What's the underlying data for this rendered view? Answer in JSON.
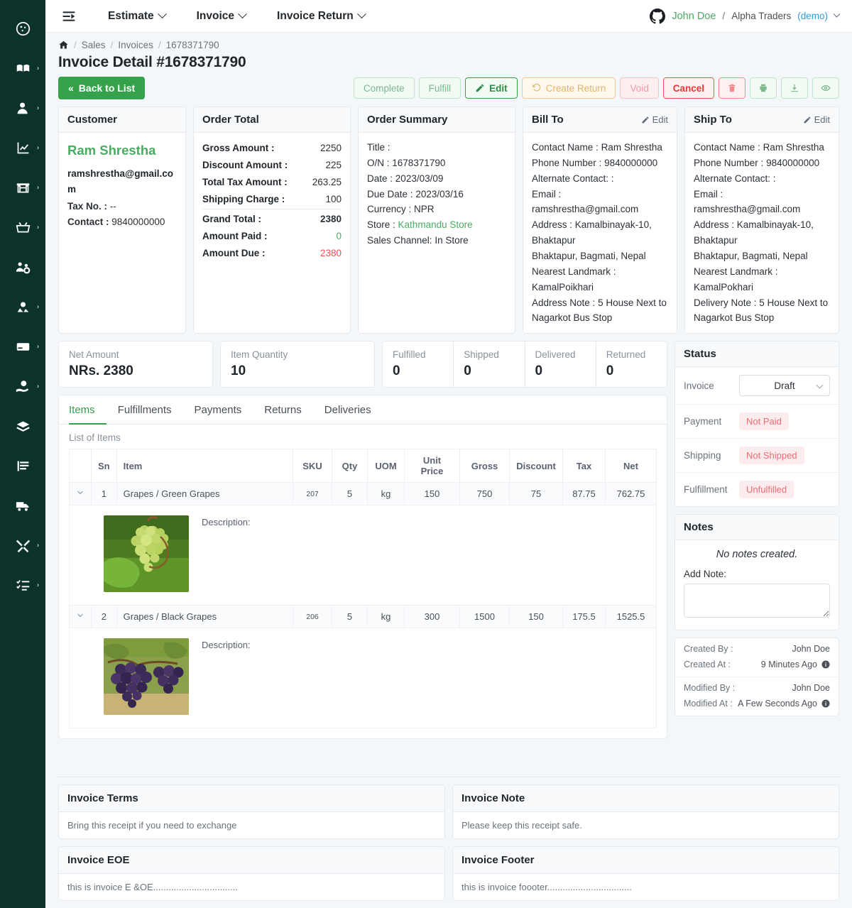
{
  "sidebar": {
    "items": [
      {
        "name": "dashboard",
        "icon": "dashboard-icon",
        "has_caret": false
      },
      {
        "name": "catalog",
        "icon": "book-icon",
        "has_caret": true
      },
      {
        "name": "customers",
        "icon": "user-icon",
        "has_caret": true
      },
      {
        "name": "reports",
        "icon": "chart-line-icon",
        "has_caret": true
      },
      {
        "name": "store",
        "icon": "store-icon",
        "has_caret": true
      },
      {
        "name": "sales",
        "icon": "basket-icon",
        "has_caret": true
      },
      {
        "name": "staff",
        "icon": "users-gear-icon",
        "has_caret": false
      },
      {
        "name": "suppliers",
        "icon": "people-icon",
        "has_caret": true
      },
      {
        "name": "payments",
        "icon": "card-icon",
        "has_caret": true
      },
      {
        "name": "expenses",
        "icon": "hand-money-icon",
        "has_caret": false
      },
      {
        "name": "inventory",
        "icon": "layers-icon",
        "has_caret": false
      },
      {
        "name": "accounting",
        "icon": "ledger-icon",
        "has_caret": false
      },
      {
        "name": "shipping",
        "icon": "truck-icon",
        "has_caret": false
      },
      {
        "name": "tools",
        "icon": "tools-icon",
        "has_caret": true
      },
      {
        "name": "tasks",
        "icon": "checklist-icon",
        "has_caret": true
      }
    ]
  },
  "topbar": {
    "fold_icon": "menu-fold-icon",
    "nav": [
      {
        "label": "Estimate",
        "has_chevron": true
      },
      {
        "label": "Invoice",
        "has_chevron": true
      },
      {
        "label": "Invoice Return",
        "has_chevron": true
      }
    ],
    "user": {
      "avatar_icon": "github-icon",
      "name": "John Doe",
      "separator": "/",
      "org": "Alpha Traders",
      "demo": "(demo)"
    }
  },
  "breadcrumb": {
    "home_icon": "home-icon",
    "items": [
      "Sales",
      "Invoices",
      "1678371790"
    ]
  },
  "page_title": "Invoice Detail #1678371790",
  "actions": {
    "back_label": "Back to List",
    "buttons": [
      {
        "label": "Complete",
        "style": "muted-green",
        "icon": null
      },
      {
        "label": "Fulfill",
        "style": "muted-green",
        "icon": null
      },
      {
        "label": "Edit",
        "style": "solid-green",
        "icon": "pencil-icon"
      },
      {
        "label": "Create Return",
        "style": "warn",
        "icon": "undo-icon"
      },
      {
        "label": "Void",
        "style": "pink",
        "icon": null
      },
      {
        "label": "Cancel",
        "style": "red",
        "icon": null
      },
      {
        "label": "",
        "style": "icon-red",
        "icon": "trash-icon"
      },
      {
        "label": "",
        "style": "icon-green",
        "icon": "print-icon"
      },
      {
        "label": "",
        "style": "icon-green",
        "icon": "download-icon"
      },
      {
        "label": "",
        "style": "icon-green",
        "icon": "eye-icon"
      }
    ]
  },
  "customer": {
    "title": "Customer",
    "name": "Ram Shrestha",
    "email": "ramshrestha@gmail.com",
    "tax_label": "Tax No. :",
    "tax_value": "--",
    "contact_label": "Contact :",
    "contact_value": "9840000000"
  },
  "order_total": {
    "title": "Order Total",
    "lines": [
      {
        "label": "Gross Amount :",
        "value": "2250",
        "color": ""
      },
      {
        "label": "Discount Amount :",
        "value": "225",
        "color": ""
      },
      {
        "label": "Total Tax Amount :",
        "value": "263.25",
        "color": ""
      },
      {
        "label": "Shipping Charge :",
        "value": "100",
        "color": ""
      },
      {
        "label": "Grand Total :",
        "value": "2380",
        "color": "",
        "divider": true
      },
      {
        "label": "Amount Paid :",
        "value": "0",
        "color": "green"
      },
      {
        "label": "Amount Due :",
        "value": "2380",
        "color": "red"
      }
    ]
  },
  "order_summary": {
    "title": "Order Summary",
    "lines": [
      {
        "label": "Title :",
        "value": ""
      },
      {
        "label": "O/N :",
        "value": "1678371790"
      },
      {
        "label": "Date :",
        "value": "2023/03/09"
      },
      {
        "label": "Due Date :",
        "value": "2023/03/16"
      },
      {
        "label": "Currency :",
        "value": "NPR"
      },
      {
        "label": "Store :",
        "value": "Kathmandu Store",
        "link": true
      },
      {
        "label": "Sales Channel:",
        "value": "In Store"
      }
    ]
  },
  "bill_to": {
    "title": "Bill To",
    "edit_label": "Edit",
    "lines": [
      {
        "label": "Contact Name :",
        "value": "Ram Shrestha"
      },
      {
        "label": "Phone Number :",
        "value": "9840000000"
      },
      {
        "label": "Alternate Contact: :",
        "value": ""
      },
      {
        "label": "Email :",
        "value": "ramshrestha@gmail.com"
      },
      {
        "label": "Address :",
        "value": "Kamalbinayak-10, Bhaktapur"
      },
      {
        "label": "",
        "value": "Bhaktapur, Bagmati, Nepal",
        "plain": true
      },
      {
        "label": "Nearest Landmark :",
        "value": "KamalPoikhari"
      },
      {
        "label": "Address Note :",
        "value": "5 House Next to Nagarkot Bus Stop"
      }
    ]
  },
  "ship_to": {
    "title": "Ship To",
    "edit_label": "Edit",
    "lines": [
      {
        "label": "Contact Name :",
        "value": "Ram Shrestha"
      },
      {
        "label": "Phone Number :",
        "value": "9840000000"
      },
      {
        "label": "Alternate Contact: :",
        "value": ""
      },
      {
        "label": "Email :",
        "value": "ramshrestha@gmail.com"
      },
      {
        "label": "Address :",
        "value": "Kamalbinayak-10, Bhaktapur"
      },
      {
        "label": "",
        "value": "Bhaktapur, Bagmati, Nepal",
        "plain": true
      },
      {
        "label": "Nearest Landmark :",
        "value": "KamalPokhari"
      },
      {
        "label": "Delivery Note :",
        "value": "5 House Next to Nagarkot Bus Stop"
      }
    ]
  },
  "stats": {
    "net_amount": {
      "label": "Net Amount",
      "value": "NRs. 2380"
    },
    "item_quantity": {
      "label": "Item Quantity",
      "value": "10"
    },
    "quad": [
      {
        "label": "Fulfilled",
        "value": "0"
      },
      {
        "label": "Shipped",
        "value": "0"
      },
      {
        "label": "Delivered",
        "value": "0"
      },
      {
        "label": "Returned",
        "value": "0"
      }
    ]
  },
  "tabs": [
    {
      "label": "Items",
      "active": true
    },
    {
      "label": "Fulfillments",
      "active": false
    },
    {
      "label": "Payments",
      "active": false
    },
    {
      "label": "Returns",
      "active": false
    },
    {
      "label": "Deliveries",
      "active": false
    }
  ],
  "items_panel": {
    "list_label": "List of Items",
    "columns": [
      "",
      "Sn",
      "Item",
      "SKU",
      "Qty",
      "UOM",
      "Unit Price",
      "Gross",
      "Discount",
      "Tax",
      "Net"
    ],
    "description_label": "Description:",
    "rows": [
      {
        "sn": "1",
        "item": "Grapes / Green Grapes",
        "sku": "207",
        "qty": "5",
        "uom": "kg",
        "unit_price": "150",
        "gross": "750",
        "discount": "75",
        "tax": "87.75",
        "net": "762.75",
        "thumb": "green-grapes-photo",
        "description": ""
      },
      {
        "sn": "2",
        "item": "Grapes / Black Grapes",
        "sku": "206",
        "qty": "5",
        "uom": "kg",
        "unit_price": "300",
        "gross": "1500",
        "discount": "150",
        "tax": "175.5",
        "net": "1525.5",
        "thumb": "black-grapes-photo",
        "description": ""
      }
    ]
  },
  "status_panel": {
    "title": "Status",
    "invoice_label": "Invoice",
    "invoice_value": "Draft",
    "payment_label": "Payment",
    "payment_value": "Not Paid",
    "shipping_label": "Shipping",
    "shipping_value": "Not Shipped",
    "fulfillment_label": "Fulfillment",
    "fulfillment_value": "Unfulfilled"
  },
  "notes_panel": {
    "title": "Notes",
    "empty_text": "No notes created.",
    "add_label": "Add Note:",
    "textarea_value": ""
  },
  "meta": {
    "created_by_label": "Created By :",
    "created_by_value": "John Doe",
    "created_at_label": "Created At :",
    "created_at_value": "9 Minutes Ago",
    "modified_by_label": "Modified By :",
    "modified_by_value": "John Doe",
    "modified_at_label": "Modified At :",
    "modified_at_value": "A Few Seconds Ago"
  },
  "bottom_cards": [
    {
      "title": "Invoice Terms",
      "body": "Bring this receipt if you need to exchange"
    },
    {
      "title": "Invoice Note",
      "body": "Please keep this receipt safe."
    },
    {
      "title": "Invoice EOE",
      "body": "this is invoice E &OE................................."
    },
    {
      "title": "Invoice Footer",
      "body": "this is invoice foooter................................."
    }
  ],
  "colors": {
    "sidebar_bg": "#0c332b",
    "accent_green": "#35a14a",
    "link_green": "#4bab62",
    "danger_red": "#ef5350",
    "page_bg": "#f4f7fa"
  }
}
